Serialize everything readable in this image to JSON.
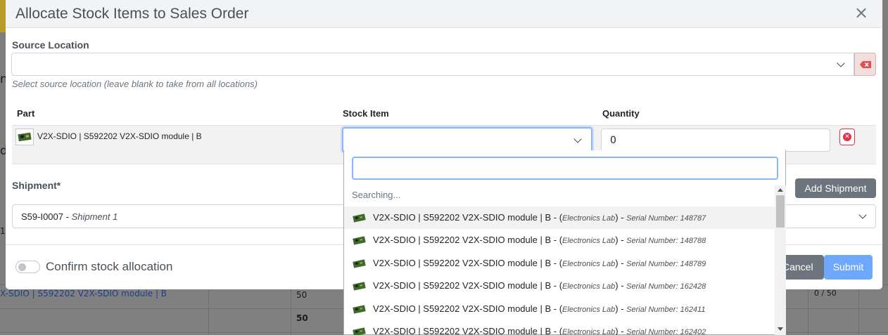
{
  "modal": {
    "title": "Allocate Stock Items to Sales Order",
    "source_location": {
      "label": "Source Location",
      "value": "",
      "help": "Select source location (leave blank to take from all locations)"
    },
    "table": {
      "headers": {
        "part": "Part",
        "stock_item": "Stock Item",
        "quantity": "Quantity"
      },
      "row": {
        "part": "V2X-SDIO | S592202 V2X-SDIO module | B",
        "stock_item": "",
        "quantity": "0"
      }
    },
    "shipment": {
      "label": "Shipment*",
      "code": "S59-I0007",
      "separator": " - ",
      "name": "Shipment 1",
      "add_button": "Add Shipment"
    },
    "footer": {
      "confirm_label": "Confirm stock allocation",
      "confirm_checked": false,
      "cancel": "Cancel",
      "submit": "Submit"
    }
  },
  "dropdown": {
    "search_value": "",
    "status": "Searching...",
    "items": [
      {
        "name": "V2X-SDIO | S592202 V2X-SDIO module | B - (",
        "location": "Electronics Lab",
        "mid": ") - ",
        "serial_label": "Serial Number: ",
        "serial": "148787"
      },
      {
        "name": "V2X-SDIO | S592202 V2X-SDIO module | B - (",
        "location": "Electronics Lab",
        "mid": ") - ",
        "serial_label": "Serial Number: ",
        "serial": "148788"
      },
      {
        "name": "V2X-SDIO | S592202 V2X-SDIO module | B - (",
        "location": "Electronics Lab",
        "mid": ") - ",
        "serial_label": "Serial Number: ",
        "serial": "148789"
      },
      {
        "name": "V2X-SDIO | S592202 V2X-SDIO module | B - (",
        "location": "Electronics Lab",
        "mid": ") - ",
        "serial_label": "Serial Number: ",
        "serial": "162428"
      },
      {
        "name": "V2X-SDIO | S592202 V2X-SDIO module | B - (",
        "location": "Electronics Lab",
        "mid": ") - ",
        "serial_label": "Serial Number: ",
        "serial": "162411"
      },
      {
        "name": "V2X-SDIO | S592202 V2X-SDIO module | B - (",
        "location": "Electronics Lab",
        "mid": ") - ",
        "serial_label": "Serial Number: ",
        "serial": "162402"
      }
    ]
  },
  "background": {
    "edge_chars": [
      "n",
      "d",
      "1"
    ],
    "row_link": "X-SDIO | S592202 V2X-SDIO module | B",
    "row_qty": "50",
    "row_alloc": "0 / 50",
    "total_qty": "50"
  },
  "colors": {
    "primary_light": "#6ea8fe",
    "secondary": "#6c757d",
    "danger": "#dc3545",
    "focus_border": "#86b7fe"
  }
}
